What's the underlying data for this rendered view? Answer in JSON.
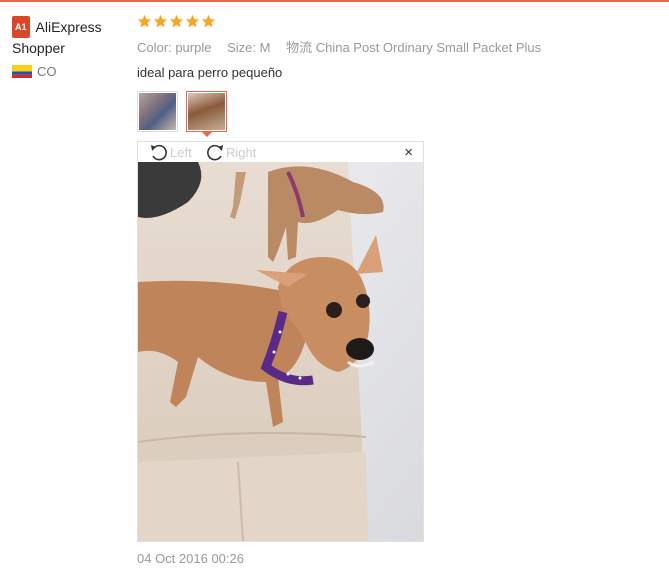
{
  "user": {
    "badge": "A1",
    "name": "AliExpress Shopper",
    "country": "CO"
  },
  "feedback": {
    "rating": 5,
    "color_label": "Color:",
    "color_value": "purple",
    "size_label": "Size:",
    "size_value": "M",
    "shipping_label": "物流",
    "shipping_value": "China Post Ordinary Small Packet Plus",
    "text": "ideal para perro pequeño",
    "date": "04 Oct 2016 00:26"
  },
  "viewer": {
    "rotate_left": "Left",
    "rotate_right": "Right",
    "close": "×"
  },
  "colors": {
    "star": "#f5a623",
    "accent": "#e6674a",
    "badge": "#d9472b"
  }
}
